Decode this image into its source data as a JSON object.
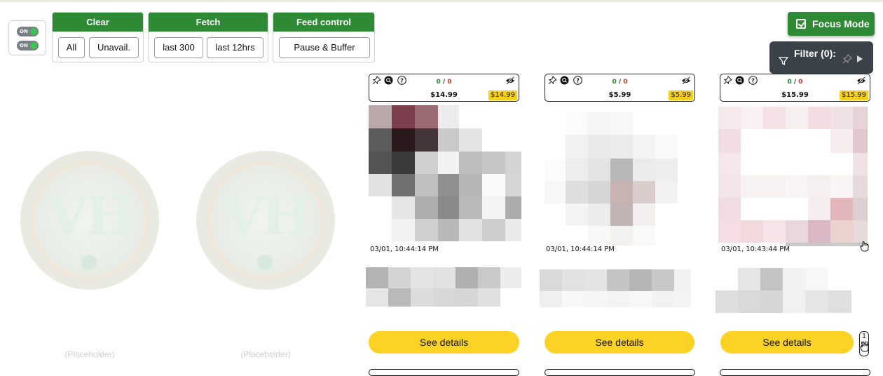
{
  "toggles": [
    {
      "label": "ON"
    },
    {
      "label": "ON"
    }
  ],
  "groups": {
    "clear": {
      "title": "Clear",
      "buttons": [
        "All",
        "Unavail."
      ]
    },
    "fetch": {
      "title": "Fetch",
      "buttons": [
        "last 300",
        "last 12hrs"
      ]
    },
    "feed": {
      "title": "Feed control",
      "buttons": [
        "Pause & Buffer"
      ]
    }
  },
  "focus_mode": {
    "label": "Focus Mode",
    "checked": true
  },
  "filter": {
    "label": "Filter (0):"
  },
  "placeholders": [
    {
      "label": "(Placeholder)",
      "logo_text": "VH"
    },
    {
      "label": "(Placeholder)",
      "logo_text": "VH"
    }
  ],
  "cards": [
    {
      "count_green": "0",
      "count_sep": "/",
      "count_red": "0",
      "price": "$14.99",
      "badge_price": "$14.99",
      "timestamp": "03/01, 10:44:14 PM",
      "button": "See details"
    },
    {
      "count_green": "0",
      "count_sep": "/",
      "count_red": "0",
      "price": "$5.99",
      "badge_price": "$5.99",
      "timestamp": "03/01, 10:44:14 PM",
      "button": "See details"
    },
    {
      "count_green": "0",
      "count_sep": "/",
      "count_red": "0",
      "price": "$15.99",
      "badge_price": "$15.99",
      "timestamp": "03/01, 10:43:44 PM",
      "button": "See details"
    }
  ],
  "corner_widget": {
    "number": "1"
  },
  "colors": {
    "green": "#2e8a35",
    "yellow": "#fcd225",
    "dark_panel": "#3b4148"
  },
  "icons": [
    "pin-icon",
    "zoom-icon",
    "help-icon",
    "eye-off-icon",
    "filter-icon",
    "play-icon",
    "checkbox-icon",
    "hand-cursor-icon"
  ]
}
